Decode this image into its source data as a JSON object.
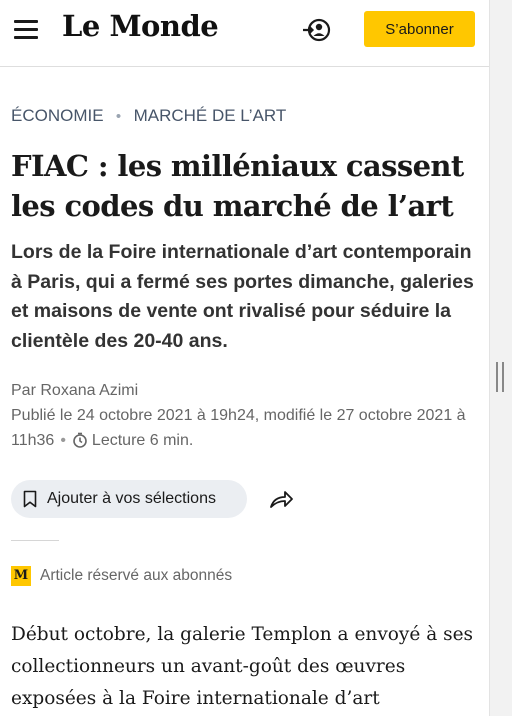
{
  "header": {
    "logo": "Le Monde",
    "subscribe_label": "S’abonner"
  },
  "breadcrumb": {
    "section": "ÉCONOMIE",
    "separator": "•",
    "subsection": "MARCHÉ DE L’ART"
  },
  "article": {
    "title": "FIAC : les milléniaux cassent les codes du marché de l’art",
    "lede": "Lors de la Foire internationale d’art contemporain à Paris, qui a fermé ses portes dimanche, galeries et maisons de vente ont rivalisé pour séduire la clientèle des 20-40 ans.",
    "byline_prefix": "Par",
    "author": "Roxana Azimi",
    "published": "Publié le 24 octobre 2021 à 19h24, modifié le 27 octobre 2021 à 11h36",
    "meta_separator": "•",
    "reading_time": "Lecture 6 min.",
    "save_label": "Ajouter à vos sélections",
    "subscriber_badge": "M",
    "subscriber_label": "Article réservé aux abonnés",
    "body_start": "Début octobre, la galerie Templon a envoyé à ses collectionneurs un avant-goût des œuvres exposées à la Foire internationale d’art"
  },
  "icons": {
    "menu": "hamburger-icon",
    "account": "account-icon",
    "clock": "clock-icon",
    "bookmark": "bookmark-icon",
    "share": "share-icon"
  },
  "colors": {
    "accent": "#ffc700",
    "breadcrumb": "#475569",
    "meta": "#666666",
    "save_button_bg": "#ebeef2"
  }
}
